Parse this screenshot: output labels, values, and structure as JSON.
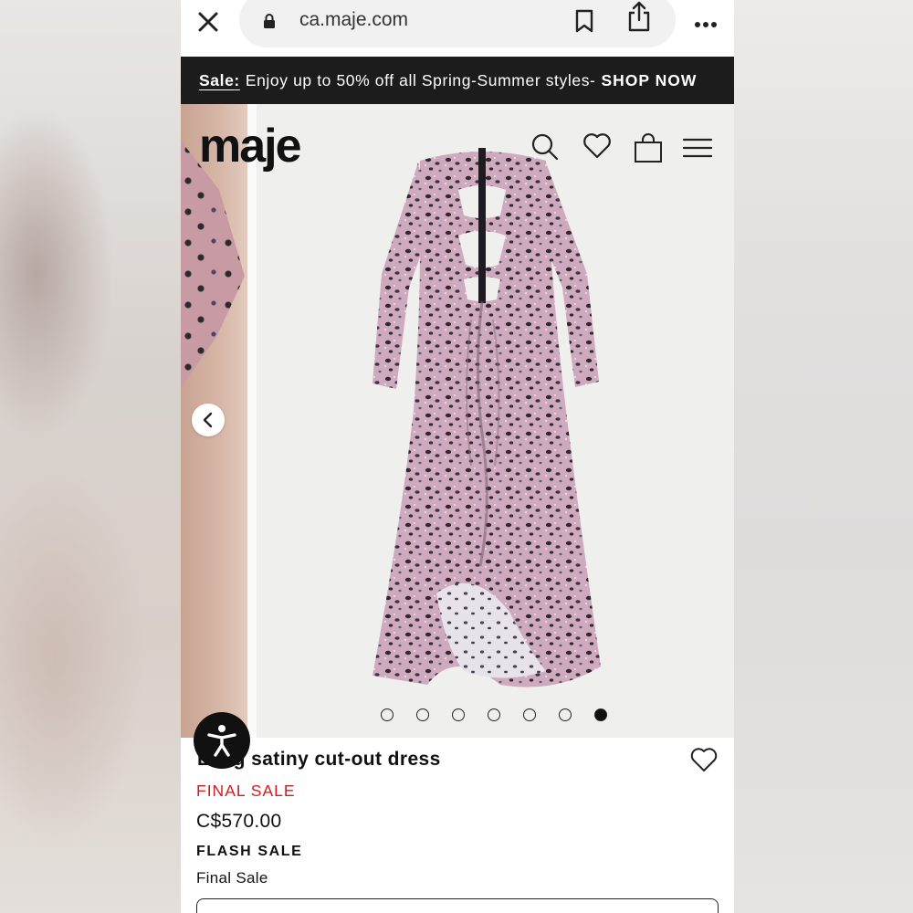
{
  "browser": {
    "url": "ca.maje.com"
  },
  "banner": {
    "sale_label": "Sale:",
    "message": "Enjoy up to 50% off all Spring-Summer styles-",
    "cta": "SHOP NOW"
  },
  "header": {
    "logo": "maje"
  },
  "gallery": {
    "slide_count": 7,
    "active_index": 6
  },
  "product": {
    "title": "Long satiny cut-out dress",
    "final_sale_tag": "FINAL SALE",
    "price": "C$570.00",
    "flash_sale": "FLASH SALE",
    "final_sale_text": "Final Sale"
  },
  "colors": {
    "banner_bg": "#1c1c1c",
    "final_sale_red": "#d01c1c",
    "dress_pink": "#c9a3b7"
  }
}
